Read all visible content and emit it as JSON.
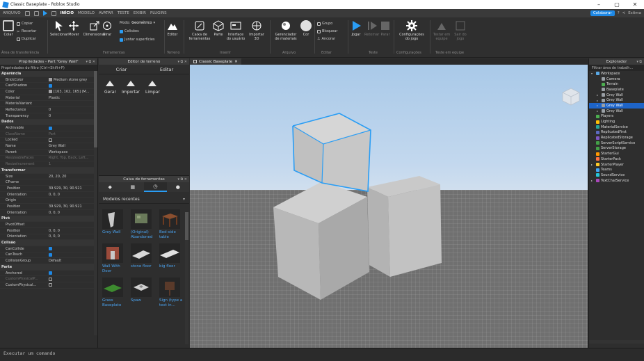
{
  "window": {
    "title": "Classic Baseplate - Roblox Studio",
    "minimize": "–",
    "restore": "▢",
    "close": "✕"
  },
  "menu": {
    "items": [
      "ARQUIVO",
      "INÍCIO",
      "MODELO",
      "AVATAR",
      "TESTE",
      "EXIBIR",
      "PLUGINS"
    ],
    "active": "INÍCIO",
    "collaborate": "Colaborar",
    "user": "Estima"
  },
  "ribbon": {
    "clipboard": {
      "copy": "Copiar",
      "cut": "Recortar",
      "paste": "Colar",
      "duplicate": "Duplicar",
      "group": "Área de transferência"
    },
    "tools": {
      "select": "Selecionar",
      "move": "Mover",
      "scale": "Dimensionar",
      "rotate": "Girar",
      "group": "Ferramentas"
    },
    "mode": {
      "label": "Modo:",
      "value": "Geométrico",
      "collisions": "Colisões",
      "join": "Juntar superfícies"
    },
    "terrain": {
      "editor": "Editor",
      "group": "Terreno"
    },
    "insert": {
      "toolbox": "Caixa de ferramentas",
      "part": "Parte",
      "ui": "Interface do usuário",
      "import3d": "Importar 3D",
      "group": "Inserir"
    },
    "file": {
      "material": "Gerenciador de materiais",
      "color": "Cor",
      "group": "Arquivo"
    },
    "edit": {
      "group_btn": "Grupo",
      "lock": "Bloquear",
      "anchor": "Ancorar",
      "group": "Editar"
    },
    "test": {
      "play": "Jogar",
      "resume": "Retomar",
      "stop": "Parar",
      "group": "Teste"
    },
    "settings": {
      "game": "Configurações do jogo",
      "group": "Configurações"
    },
    "team": {
      "create": "Testar em equipe",
      "exit": "Sair do jogo",
      "group": "Teste em equipe"
    }
  },
  "properties": {
    "title": "Propriedades - Part \"Grey Wall\"",
    "filter": "Propriedades do filtro (Ctrl+Shift+P)",
    "rows": [
      {
        "k": "Aparência",
        "type": "section"
      },
      {
        "k": "BrickColor",
        "v": "Medium stone grey",
        "swatch": "#a3a2a5"
      },
      {
        "k": "CastShadow",
        "check": true
      },
      {
        "k": "Color",
        "v": "[163, 162, 165] (M...",
        "swatch": "#a3a2a5"
      },
      {
        "k": "Material",
        "v": "Plastic"
      },
      {
        "k": "MaterialVariant",
        "v": ""
      },
      {
        "k": "Reflectance",
        "v": "0"
      },
      {
        "k": "Transparency",
        "v": "0"
      },
      {
        "k": "Dados",
        "type": "section"
      },
      {
        "k": "Archivable",
        "check": true
      },
      {
        "k": "ClassName",
        "v": "Part",
        "dim": true
      },
      {
        "k": "Locked",
        "check": false
      },
      {
        "k": "Name",
        "v": "Grey Wall"
      },
      {
        "k": "Parent",
        "v": "Workspace"
      },
      {
        "k": "ResizeableFaces",
        "v": "Right, Top, Back, Left...",
        "dim": true
      },
      {
        "k": "ResizeIncrement",
        "v": "1",
        "dim": true
      },
      {
        "k": "Transformar",
        "type": "section"
      },
      {
        "k": "Size",
        "v": "20, 20, 20"
      },
      {
        "k": "CFrame",
        "v": ""
      },
      {
        "k": "Position",
        "v": "39.929, 30, 90.921",
        "sub": true
      },
      {
        "k": "Orientation",
        "v": "0, 0, 0",
        "sub": true
      },
      {
        "k": "Origin",
        "v": ""
      },
      {
        "k": "Position",
        "v": "39.929, 30, 90.921",
        "sub": true
      },
      {
        "k": "Orientation",
        "v": "0, 0, 0",
        "sub": true
      },
      {
        "k": "Pivô",
        "type": "section"
      },
      {
        "k": "PivotOffset",
        "v": ""
      },
      {
        "k": "Position",
        "v": "0, 0, 0",
        "sub": true
      },
      {
        "k": "Orientation",
        "v": "0, 0, 0",
        "sub": true
      },
      {
        "k": "Colisão",
        "type": "section"
      },
      {
        "k": "CanCollide",
        "check": true
      },
      {
        "k": "CanTouch",
        "check": true
      },
      {
        "k": "CollisionGroup",
        "v": "Default"
      },
      {
        "k": "Parte",
        "type": "section"
      },
      {
        "k": "Anchored",
        "check": true
      },
      {
        "k": "CustomPhysicalP...",
        "check": false,
        "dim": true
      },
      {
        "k": "CustomPhysical...",
        "check": false
      }
    ]
  },
  "terrain_editor": {
    "title": "Editor de terreno",
    "tabs": [
      "Criar",
      "Editar"
    ],
    "tools": [
      "Gerar",
      "Importar",
      "Limpar"
    ]
  },
  "toolbox": {
    "title": "Caixa de ferramentas",
    "category": "Modelos recentes",
    "models": [
      "Grey Wall",
      "(Original) Abandoned",
      "Bed-side table",
      "Wall With Door",
      "stone floor",
      "big floor",
      "Grass Baseplate",
      "Spaw",
      "Sign (type a text in..."
    ]
  },
  "viewport": {
    "tab": "Classic Baseplate"
  },
  "explorer": {
    "title": "Explorador",
    "filter": "Filtrar área de trabalh...",
    "items": [
      {
        "label": "Workspace",
        "depth": 0,
        "arrow": "▾",
        "color": "#5aa9e6"
      },
      {
        "label": "Camera",
        "depth": 1,
        "color": "#9aa0a6"
      },
      {
        "label": "Terrain",
        "depth": 1,
        "color": "#4caf50"
      },
      {
        "label": "Baseplate",
        "depth": 1,
        "color": "#9aa0a6"
      },
      {
        "label": "Grey Wall",
        "depth": 1,
        "arrow": "▸",
        "color": "#9aa0a6"
      },
      {
        "label": "Grey Wall",
        "depth": 1,
        "arrow": "▸",
        "color": "#9aa0a6"
      },
      {
        "label": "Grey Wall",
        "depth": 1,
        "arrow": "▸",
        "color": "#9aa0a6",
        "selected": true
      },
      {
        "label": "Grey Wall",
        "depth": 1,
        "arrow": "▸",
        "color": "#9aa0a6"
      },
      {
        "label": "Players",
        "depth": 0,
        "color": "#4caf50"
      },
      {
        "label": "Lighting",
        "depth": 0,
        "color": "#ffc107"
      },
      {
        "label": "MaterialService",
        "depth": 0,
        "color": "#26a69a"
      },
      {
        "label": "ReplicatedFirst",
        "depth": 0,
        "color": "#5c6bc0"
      },
      {
        "label": "ReplicatedStorage",
        "depth": 0,
        "color": "#7e57c2"
      },
      {
        "label": "ServerScriptService",
        "depth": 0,
        "color": "#43a047"
      },
      {
        "label": "ServerStorage",
        "depth": 0,
        "color": "#43a047"
      },
      {
        "label": "StarterGui",
        "depth": 0,
        "color": "#ff9800"
      },
      {
        "label": "StarterPack",
        "depth": 0,
        "color": "#ff7043"
      },
      {
        "label": "StarterPlayer",
        "depth": 0,
        "arrow": "▸",
        "color": "#ffca28"
      },
      {
        "label": "Teams",
        "depth": 0,
        "color": "#42a5f5"
      },
      {
        "label": "SoundService",
        "depth": 0,
        "color": "#26c6da"
      },
      {
        "label": "TextChatService",
        "depth": 0,
        "arrow": "▸",
        "color": "#ab47bc"
      }
    ]
  },
  "command_bar": {
    "placeholder": "Executar um comando"
  }
}
